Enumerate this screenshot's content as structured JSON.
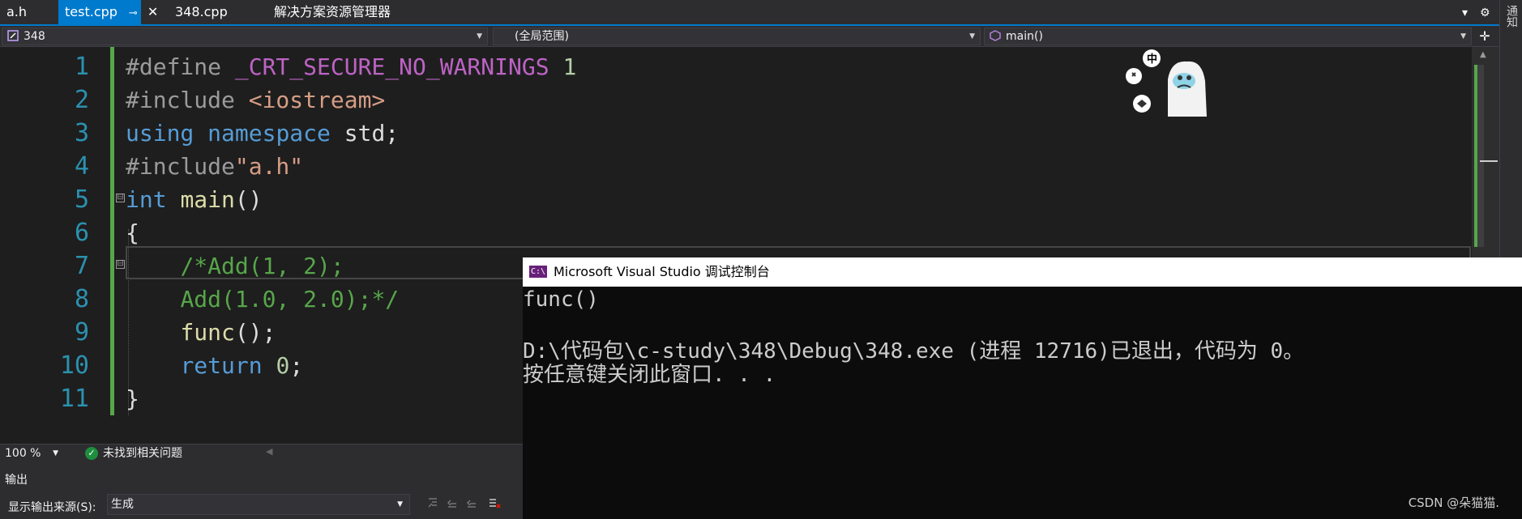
{
  "tabs": [
    {
      "label": "a.h",
      "active": false
    },
    {
      "label": "test.cpp",
      "active": true,
      "pin": "⊸",
      "close": "✕"
    },
    {
      "label": "348.cpp",
      "active": false
    },
    {
      "label": "解决方案资源管理器",
      "active": false
    }
  ],
  "tabbar_buttons": {
    "dropdown": "▾",
    "settings": "⚙"
  },
  "right_strip": {
    "notifications": "通知"
  },
  "navbar": {
    "project": "348",
    "scope": "(全局范围)",
    "member": "main()",
    "split": "✛"
  },
  "editor": {
    "line_numbers": [
      "1",
      "2",
      "3",
      "4",
      "5",
      "6",
      "7",
      "8",
      "9",
      "10",
      "11"
    ],
    "lines": [
      [
        {
          "c": "pp",
          "t": "#define "
        },
        {
          "c": "mac",
          "t": "_CRT_SECURE_NO_WARNINGS"
        },
        {
          "c": "num",
          "t": " 1"
        }
      ],
      [
        {
          "c": "pp",
          "t": "#include "
        },
        {
          "c": "str",
          "t": "<iostream>"
        }
      ],
      [
        {
          "c": "kw",
          "t": "using"
        },
        {
          "c": "",
          "t": " "
        },
        {
          "c": "kw",
          "t": "namespace"
        },
        {
          "c": "",
          "t": " std;"
        }
      ],
      [
        {
          "c": "pp",
          "t": "#include"
        },
        {
          "c": "str",
          "t": "\"a.h\""
        }
      ],
      [
        {
          "c": "kw",
          "t": "int"
        },
        {
          "c": "",
          "t": " "
        },
        {
          "c": "fn",
          "t": "main"
        },
        {
          "c": "",
          "t": "()"
        }
      ],
      [
        {
          "c": "",
          "t": "{"
        }
      ],
      [
        {
          "c": "",
          "t": "    "
        },
        {
          "c": "cmt",
          "t": "/*Add(1, 2);"
        }
      ],
      [
        {
          "c": "",
          "t": "    "
        },
        {
          "c": "cmt",
          "t": "Add(1.0, 2.0);*/"
        }
      ],
      [
        {
          "c": "",
          "t": "    "
        },
        {
          "c": "fn",
          "t": "func"
        },
        {
          "c": "",
          "t": "();"
        }
      ],
      [
        {
          "c": "",
          "t": "    "
        },
        {
          "c": "kw",
          "t": "return"
        },
        {
          "c": "",
          "t": " "
        },
        {
          "c": "num",
          "t": "0"
        },
        {
          "c": "",
          "t": ";"
        }
      ],
      [
        {
          "c": "",
          "t": "}"
        }
      ]
    ],
    "fold_markers": [
      "⊟",
      "⊟"
    ]
  },
  "sticker": {
    "text": "中"
  },
  "status": {
    "zoom": "100 %",
    "issues": "未找到相关问题",
    "issue_icon": "✓"
  },
  "output": {
    "title": "输出",
    "source_label": "显示输出来源(S):",
    "source_value": "生成"
  },
  "console": {
    "icon": "C:\\",
    "title": "Microsoft Visual Studio 调试控制台",
    "lines": [
      "func()",
      "",
      "D:\\代码包\\c-study\\348\\Debug\\348.exe (进程 12716)已退出，代码为 0。",
      "按任意键关闭此窗口. . ."
    ],
    "watermark": "CSDN @朵猫猫."
  }
}
